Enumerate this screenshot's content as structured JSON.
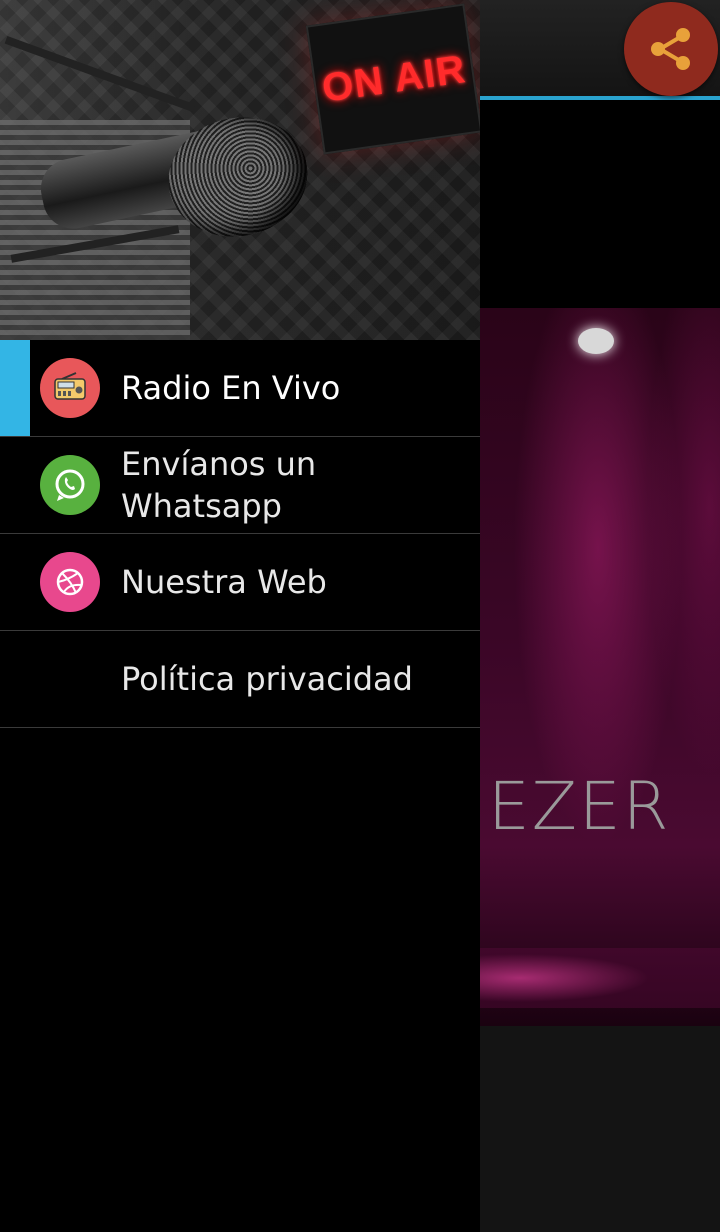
{
  "drawer": {
    "header": {
      "sign_text": "ON AIR"
    },
    "items": [
      {
        "label": "Radio En Vivo",
        "icon": "radio-icon",
        "icon_color": "#e8575a",
        "active": true
      },
      {
        "label": "Envíanos un Whatsapp",
        "icon": "whatsapp-icon",
        "icon_color": "#58b13f",
        "active": false
      },
      {
        "label": "Nuestra Web",
        "icon": "dribbble-icon",
        "icon_color": "#e8488d",
        "active": false
      },
      {
        "label": "Política privacidad",
        "icon": "",
        "active": false
      }
    ],
    "accent": "#33b5e5"
  },
  "app": {
    "share_icon": "share-icon",
    "share_color": "#8f2a1e",
    "toolbar_accent": "#2aa3cf",
    "stage_text": "EZER"
  }
}
